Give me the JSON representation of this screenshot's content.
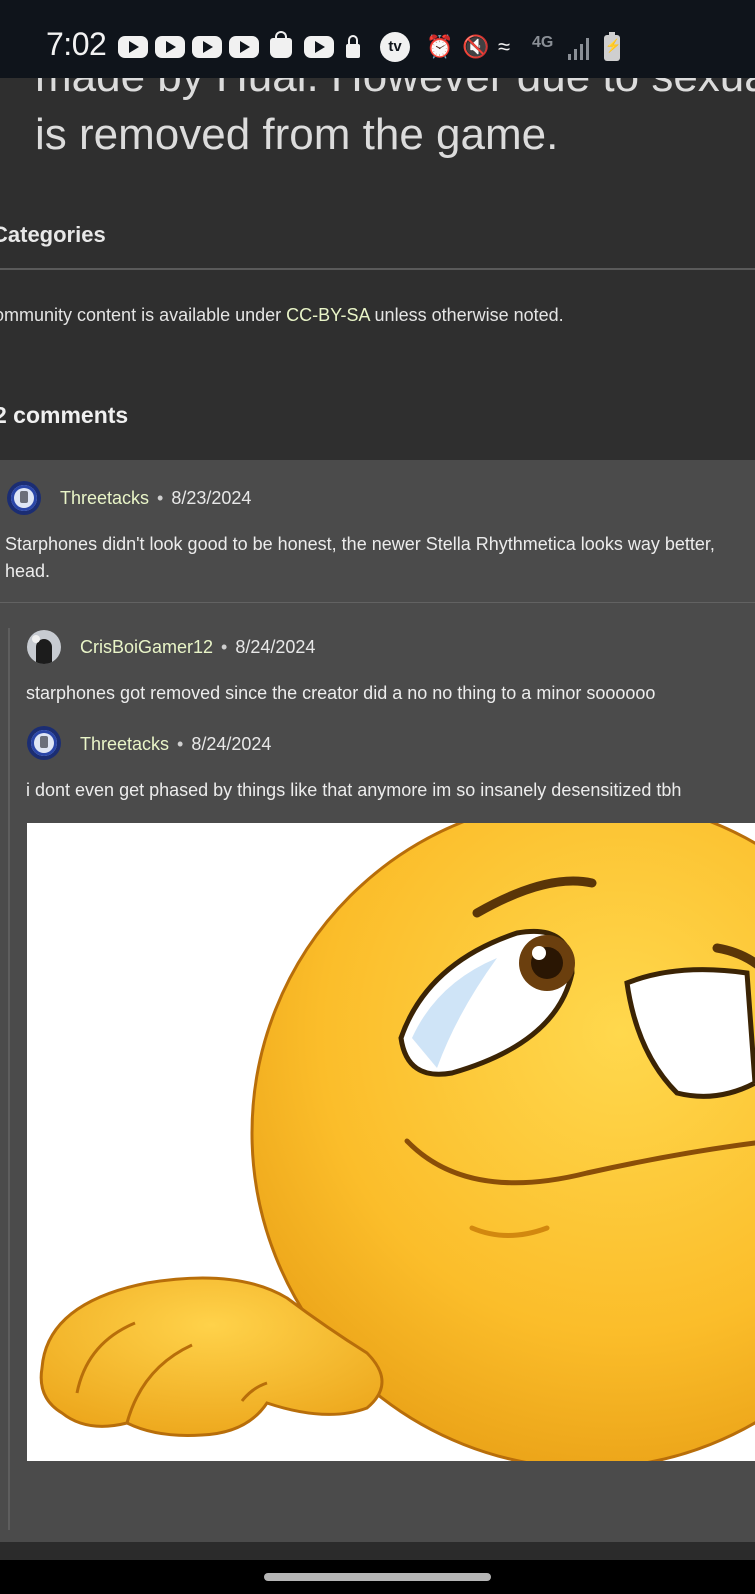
{
  "status_bar": {
    "time": "7:02",
    "network_label": "4G",
    "icons": [
      "youtube-icon",
      "youtube-icon",
      "youtube-icon",
      "youtube-icon",
      "shopping-bag-icon",
      "youtube-icon",
      "lock-icon",
      "tv-icon",
      "alarm-icon",
      "mute-icon",
      "wifi-icon",
      "network-icon",
      "signal-icon",
      "battery-icon"
    ]
  },
  "article": {
    "partial_line": "made by Huai. However due to sexua",
    "removed_line": "is removed from the game."
  },
  "categories_heading": "Categories",
  "license": {
    "prefix": "ommunity content is available under ",
    "link": "CC-BY-SA",
    "suffix": " unless otherwise noted."
  },
  "comments_heading": "2 comments",
  "comments": [
    {
      "user": "Threetacks",
      "date": "8/23/2024",
      "text": "Starphones didn't look good to be honest, the newer Stella Rhythmetica looks way better,",
      "text_cont": "head."
    }
  ],
  "replies": [
    {
      "user": "CrisBoiGamer12",
      "date": "8/24/2024",
      "text": "starphones got removed since the creator did a no no thing to a minor soooooo"
    },
    {
      "user": "Threetacks",
      "date": "8/24/2024",
      "text": "i dont even get phased by things like that anymore im so insanely desensitized tbh"
    }
  ],
  "separator": "•",
  "colors": {
    "background": "#2f2f2f",
    "comment_panel": "#4b4b4b",
    "link": "#e9f5c8",
    "status_bar": "#0f141b"
  }
}
